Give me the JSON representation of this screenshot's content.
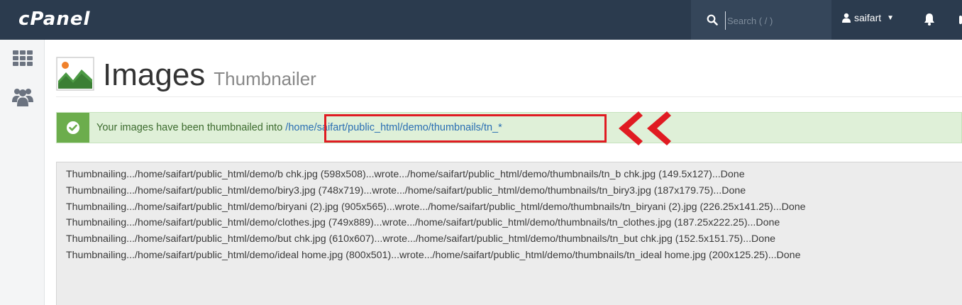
{
  "app": {
    "logo": "cPanel"
  },
  "header": {
    "search_placeholder": "Search ( / )",
    "username": "saifart"
  },
  "page": {
    "title": "Images",
    "subtitle": "Thumbnailer"
  },
  "alert": {
    "message": "Your images have been thumbnailed into",
    "path": "/home/saifart/public_html/demo/thumbnails/tn_*"
  },
  "output": {
    "lines": [
      "Thumbnailing.../home/saifart/public_html/demo/b chk.jpg (598x508)...wrote.../home/saifart/public_html/demo/thumbnails/tn_b chk.jpg (149.5x127)...Done",
      "Thumbnailing.../home/saifart/public_html/demo/biry3.jpg (748x719)...wrote.../home/saifart/public_html/demo/thumbnails/tn_biry3.jpg (187x179.75)...Done",
      "Thumbnailing.../home/saifart/public_html/demo/biryani (2).jpg (905x565)...wrote.../home/saifart/public_html/demo/thumbnails/tn_biryani (2).jpg (226.25x141.25)...Done",
      "Thumbnailing.../home/saifart/public_html/demo/clothes.jpg (749x889)...wrote.../home/saifart/public_html/demo/thumbnails/tn_clothes.jpg (187.25x222.25)...Done",
      "Thumbnailing.../home/saifart/public_html/demo/but chk.jpg (610x607)...wrote.../home/saifart/public_html/demo/thumbnails/tn_but chk.jpg (152.5x151.75)...Done",
      "Thumbnailing.../home/saifart/public_html/demo/ideal home.jpg (800x501)...wrote.../home/saifart/public_html/demo/thumbnails/tn_ideal home.jpg (200x125.25)...Done"
    ]
  },
  "colors": {
    "topbar": "#2b3b4e",
    "alert_bg": "#dff0d8",
    "alert_icon": "#6cad4c",
    "link": "#2a6eb3",
    "highlight": "#e01b22"
  },
  "icons": {
    "search": "search-icon",
    "user": "user-icon",
    "bell": "bell-icon",
    "grid": "grid-icon",
    "users": "users-icon",
    "image": "image-icon",
    "check": "check-circle-icon"
  }
}
